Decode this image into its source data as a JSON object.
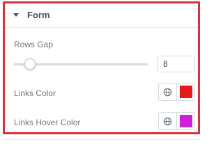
{
  "section": {
    "title": "Form"
  },
  "rows_gap": {
    "label": "Rows Gap",
    "value": "8",
    "slider_fraction": 0.08
  },
  "links_color": {
    "label": "Links Color",
    "global_icon": "globe-icon",
    "swatch_color": "#e7191a"
  },
  "links_hover_color": {
    "label": "Links Hover Color",
    "global_icon": "globe-icon",
    "swatch_color": "#cc21d8"
  },
  "colors": {
    "panel_border": "#d9323c",
    "text": "#6d7882",
    "title": "#495157"
  }
}
